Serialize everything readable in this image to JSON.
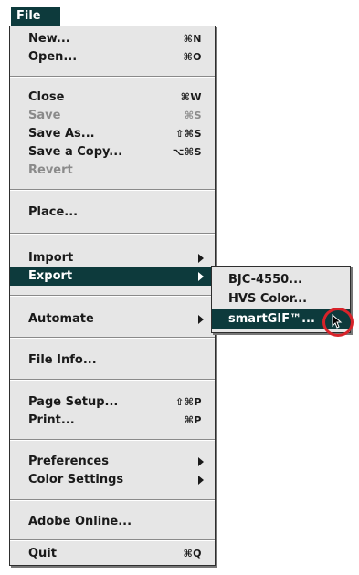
{
  "menu_title": "File",
  "menu": {
    "new": {
      "label": "New...",
      "shortcut": "⌘N"
    },
    "open": {
      "label": "Open...",
      "shortcut": "⌘O"
    },
    "close": {
      "label": "Close",
      "shortcut": "⌘W"
    },
    "save": {
      "label": "Save",
      "shortcut": "⌘S"
    },
    "save_as": {
      "label": "Save As...",
      "shortcut": "⇧⌘S"
    },
    "save_copy": {
      "label": "Save a Copy...",
      "shortcut": "⌥⌘S"
    },
    "revert": {
      "label": "Revert"
    },
    "place": {
      "label": "Place..."
    },
    "import": {
      "label": "Import"
    },
    "export": {
      "label": "Export"
    },
    "automate": {
      "label": "Automate"
    },
    "file_info": {
      "label": "File Info..."
    },
    "page_setup": {
      "label": "Page Setup...",
      "shortcut": "⇧⌘P"
    },
    "print": {
      "label": "Print...",
      "shortcut": "⌘P"
    },
    "preferences": {
      "label": "Preferences"
    },
    "color_settings": {
      "label": "Color Settings"
    },
    "adobe_online": {
      "label": "Adobe Online..."
    },
    "quit": {
      "label": "Quit",
      "shortcut": "⌘Q"
    }
  },
  "submenu": {
    "bjc": "BJC-4550...",
    "hvs": "HVS Color...",
    "smartgif": "smartGIF™..."
  },
  "colors": {
    "selection": "#0d3a3c",
    "highlight_ring": "#d8232a"
  }
}
